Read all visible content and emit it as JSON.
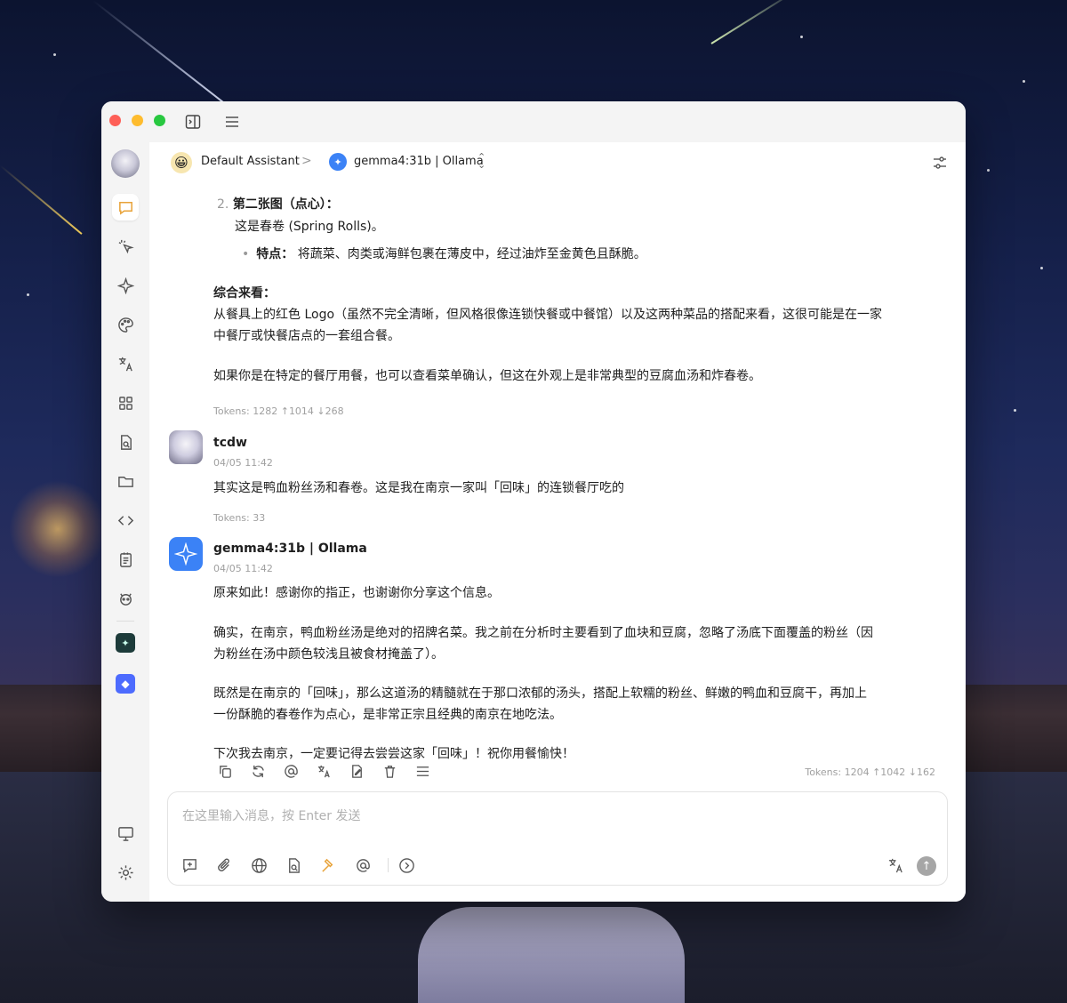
{
  "colors": {
    "accent": "#3b82f6",
    "tool_active": "#e8a33a",
    "meta": "#a0a0a0"
  },
  "topbar": {
    "assistant_emoji": "😀",
    "assistant_name": "Default Assistant",
    "separator": ">",
    "model_name": "gemma4:31b | Ollama"
  },
  "chat": {
    "m1": {
      "item_number": "2.",
      "item_title": "第二张图（点心）：",
      "item_body": "这是春卷 (Spring Rolls)。",
      "bullet_label": "特点：",
      "bullet_text": " 将蔬菜、肉类或海鲜包裹在薄皮中，经过油炸至金黄色且酥脆。",
      "summary_title": "综合来看：",
      "summary_line1": "从餐具上的红色 Logo（虽然不完全清晰，但风格很像连锁快餐或中餐馆）以及这两种菜品的搭配来看，这很可能是在一家",
      "summary_line2": "中餐厅或快餐店点的一套组合餐。",
      "advice": "如果你是在特定的餐厅用餐，也可以查看菜单确认，但这在外观上是非常典型的豆腐血汤和炸春卷。",
      "tokens": "Tokens: 1282 ↑1014 ↓268"
    },
    "m2": {
      "user": "tcdw",
      "time": "04/05 11:42",
      "text": "其实这是鸭血粉丝汤和春卷。这是我在南京一家叫「回味」的连锁餐厅吃的",
      "tokens": "Tokens: 33"
    },
    "m3": {
      "model": "gemma4:31b | Ollama",
      "time": "04/05 11:42",
      "line1": "原来如此！感谢你的指正，也谢谢你分享这个信息。",
      "line2a": "确实，在南京，鸭血粉丝汤是绝对的招牌名菜。我之前在分析时主要看到了血块和豆腐，忽略了汤底下面覆盖的粉丝（因",
      "line2b": "为粉丝在汤中颜色较浅且被食材掩盖了）。",
      "line3a": "既然是在南京的「回味」，那么这道汤的精髓就在于那口浓郁的汤头，搭配上软糯的粉丝、鲜嫩的鸭血和豆腐干，再加上",
      "line3b": "一份酥脆的春卷作为点心，是非常正宗且经典的南京在地吃法。",
      "line4": "下次我去南京，一定要记得去尝尝这家「回味」！祝你用餐愉快！",
      "tokens": "Tokens: 1204 ↑1042 ↓162"
    }
  },
  "input": {
    "placeholder": "在这里输入消息，按 Enter 发送"
  },
  "icons": {
    "titlebar": [
      "sidebar-toggle-icon",
      "menu-icon"
    ],
    "sidebar": [
      "chat-icon",
      "agent-cursor-icon",
      "sparkle-icon",
      "palette-icon",
      "translate-icon",
      "apps-grid-icon",
      "file-search-icon",
      "folder-icon",
      "code-icon",
      "notes-icon",
      "robot-icon",
      "mini-app-icon-1",
      "mini-app-icon-2",
      "monitor-icon",
      "settings-icon"
    ],
    "actions": [
      "copy-icon",
      "regenerate-icon",
      "mention-icon",
      "translate-icon",
      "edit-icon",
      "delete-icon",
      "more-icon"
    ],
    "input": [
      "new-topic-icon",
      "attachment-icon",
      "web-search-icon",
      "knowledge-icon",
      "tools-icon",
      "mention-icon",
      "expand-icon",
      "translate-icon",
      "send-icon"
    ]
  }
}
